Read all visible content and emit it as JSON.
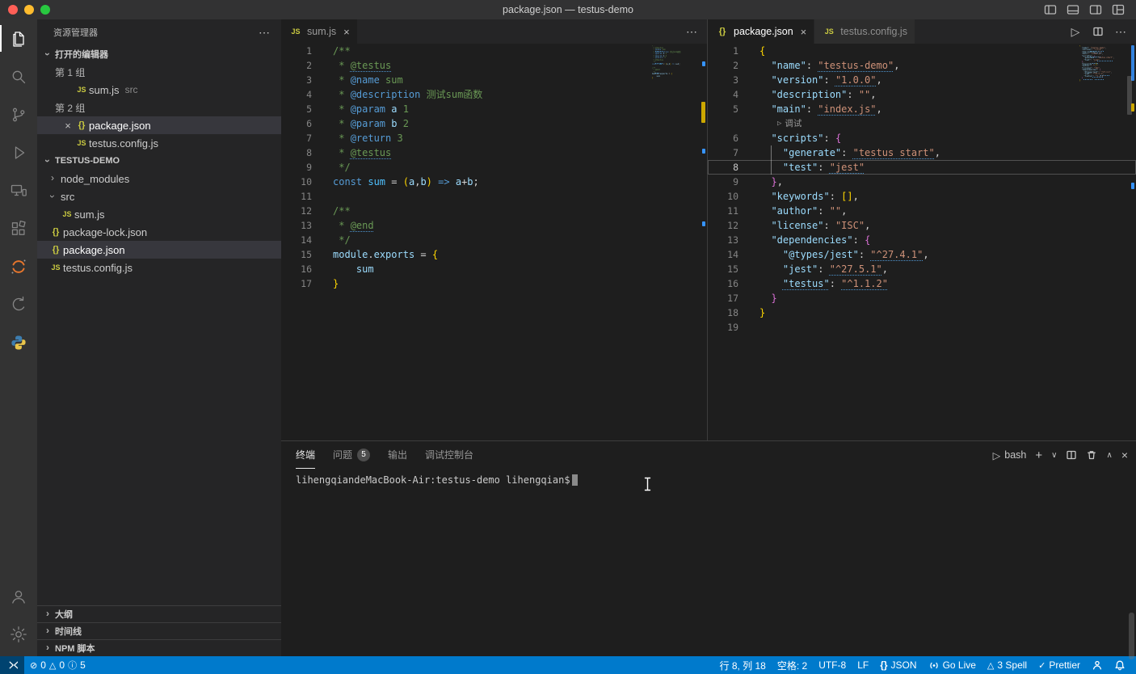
{
  "window": {
    "title": "package.json — testus-demo"
  },
  "colors": {
    "statusbar": "#007acc",
    "editor_bg": "#1e1e1e",
    "sidebar_bg": "#252526",
    "activitybar_bg": "#333333",
    "titlebar_bg": "#323233",
    "selection_row": "#37373d",
    "bracket_gold": "#ffd700",
    "bracket_pink": "#da70d6"
  },
  "titlebar_actions": [
    {
      "name": "toggle-primary-sidebar"
    },
    {
      "name": "toggle-panel"
    },
    {
      "name": "toggle-secondary-sidebar"
    },
    {
      "name": "customize-layout"
    }
  ],
  "activity_bar": {
    "top": [
      {
        "name": "explorer",
        "active": true
      },
      {
        "name": "search"
      },
      {
        "name": "source-control"
      },
      {
        "name": "run-and-debug"
      },
      {
        "name": "remote-explorer"
      },
      {
        "name": "extensions"
      },
      {
        "name": "jupyter"
      },
      {
        "name": "undo-history"
      },
      {
        "name": "python"
      }
    ],
    "bottom": [
      {
        "name": "account"
      },
      {
        "name": "settings"
      }
    ]
  },
  "sidebar": {
    "title": "资源管理器",
    "open_editors": {
      "label": "打开的编辑器",
      "groups": [
        {
          "label": "第 1 组",
          "items": [
            {
              "icon": "js",
              "label": "sum.js",
              "desc": "src"
            }
          ]
        },
        {
          "label": "第 2 组",
          "items": [
            {
              "icon": "json",
              "label": "package.json",
              "active": true,
              "closable": true
            },
            {
              "icon": "js",
              "label": "testus.config.js"
            }
          ]
        }
      ]
    },
    "project": {
      "label": "TESTUS-DEMO",
      "items": [
        {
          "kind": "folder",
          "label": "node_modules",
          "collapsed": true,
          "indent": 0
        },
        {
          "kind": "folder",
          "label": "src",
          "collapsed": false,
          "indent": 0
        },
        {
          "kind": "js",
          "label": "sum.js",
          "indent": 1
        },
        {
          "kind": "json",
          "label": "package-lock.json",
          "indent": 0
        },
        {
          "kind": "json",
          "label": "package.json",
          "indent": 0,
          "selected": true
        },
        {
          "kind": "js",
          "label": "testus.config.js",
          "indent": 0
        }
      ]
    },
    "bottom_sections": [
      {
        "label": "大纲"
      },
      {
        "label": "时间线"
      },
      {
        "label": "NPM 脚本"
      }
    ]
  },
  "editor1": {
    "tabs": [
      {
        "icon": "js",
        "label": "sum.js",
        "active": true,
        "dim": true,
        "closable": true
      }
    ],
    "lines": [
      {
        "tk": [
          {
            "t": "/**",
            "c": "cm"
          }
        ]
      },
      {
        "tk": [
          {
            "t": " * ",
            "c": "cm"
          },
          {
            "t": "@testus",
            "c": "cm u"
          }
        ]
      },
      {
        "tk": [
          {
            "t": " * ",
            "c": "cm"
          },
          {
            "t": "@name",
            "c": "tag"
          },
          {
            "t": " sum",
            "c": "cm"
          }
        ]
      },
      {
        "tk": [
          {
            "t": " * ",
            "c": "cm"
          },
          {
            "t": "@description",
            "c": "tag"
          },
          {
            "t": " 测试sum函数",
            "c": "cm"
          }
        ]
      },
      {
        "tk": [
          {
            "t": " * ",
            "c": "cm"
          },
          {
            "t": "@param",
            "c": "tag"
          },
          {
            "t": " ",
            "c": "cm"
          },
          {
            "t": "a",
            "c": "var"
          },
          {
            "t": " 1",
            "c": "cm"
          }
        ]
      },
      {
        "tk": [
          {
            "t": " * ",
            "c": "cm"
          },
          {
            "t": "@param",
            "c": "tag"
          },
          {
            "t": " ",
            "c": "cm"
          },
          {
            "t": "b",
            "c": "var"
          },
          {
            "t": " 2",
            "c": "cm"
          }
        ]
      },
      {
        "tk": [
          {
            "t": " * ",
            "c": "cm"
          },
          {
            "t": "@return",
            "c": "tag"
          },
          {
            "t": " 3",
            "c": "cm"
          }
        ]
      },
      {
        "tk": [
          {
            "t": " * ",
            "c": "cm"
          },
          {
            "t": "@testus",
            "c": "cm u"
          }
        ]
      },
      {
        "tk": [
          {
            "t": " */",
            "c": "cm"
          }
        ]
      },
      {
        "tk": [
          {
            "t": "const",
            "c": "kw"
          },
          {
            "t": " ",
            "c": "pn"
          },
          {
            "t": "sum",
            "c": "cvar"
          },
          {
            "t": " = ",
            "c": "pn"
          },
          {
            "t": "(",
            "c": "b1"
          },
          {
            "t": "a",
            "c": "var"
          },
          {
            "t": ",",
            "c": "pn"
          },
          {
            "t": "b",
            "c": "var"
          },
          {
            "t": ")",
            "c": "b1"
          },
          {
            "t": " ",
            "c": "pn"
          },
          {
            "t": "=>",
            "c": "kw"
          },
          {
            "t": " ",
            "c": "pn"
          },
          {
            "t": "a",
            "c": "var"
          },
          {
            "t": "+",
            "c": "pn"
          },
          {
            "t": "b",
            "c": "var"
          },
          {
            "t": ";",
            "c": "pn"
          }
        ]
      },
      {
        "tk": []
      },
      {
        "tk": [
          {
            "t": "/**",
            "c": "cm"
          }
        ]
      },
      {
        "tk": [
          {
            "t": " * ",
            "c": "cm"
          },
          {
            "t": "@end",
            "c": "cm u"
          }
        ]
      },
      {
        "tk": [
          {
            "t": " */",
            "c": "cm"
          }
        ]
      },
      {
        "tk": [
          {
            "t": "module",
            "c": "var"
          },
          {
            "t": ".",
            "c": "pn"
          },
          {
            "t": "exports",
            "c": "var"
          },
          {
            "t": " = ",
            "c": "pn"
          },
          {
            "t": "{",
            "c": "b1"
          }
        ]
      },
      {
        "tk": [
          {
            "t": "    ",
            "c": "pn"
          },
          {
            "t": "sum",
            "c": "var"
          }
        ]
      },
      {
        "tk": [
          {
            "t": "}",
            "c": "b1"
          }
        ]
      }
    ]
  },
  "editor2": {
    "tabs": [
      {
        "icon": "json",
        "label": "package.json",
        "active": true,
        "closable": true
      },
      {
        "icon": "js",
        "label": "testus.config.js"
      }
    ],
    "codelens_label": "调试",
    "lines": [
      {
        "tk": [
          {
            "t": "{",
            "c": "b1"
          }
        ]
      },
      {
        "tk": [
          {
            "t": "  ",
            "c": "pn"
          },
          {
            "t": "\"name\"",
            "c": "key"
          },
          {
            "t": ": ",
            "c": "pn"
          },
          {
            "t": "\"testus-demo\"",
            "c": "str u"
          },
          {
            "t": ",",
            "c": "pn"
          }
        ]
      },
      {
        "tk": [
          {
            "t": "  ",
            "c": "pn"
          },
          {
            "t": "\"version\"",
            "c": "key"
          },
          {
            "t": ": ",
            "c": "pn"
          },
          {
            "t": "\"1.0.0\"",
            "c": "str u"
          },
          {
            "t": ",",
            "c": "pn"
          }
        ]
      },
      {
        "tk": [
          {
            "t": "  ",
            "c": "pn"
          },
          {
            "t": "\"description\"",
            "c": "key"
          },
          {
            "t": ": ",
            "c": "pn"
          },
          {
            "t": "\"\"",
            "c": "str"
          },
          {
            "t": ",",
            "c": "pn"
          }
        ]
      },
      {
        "tk": [
          {
            "t": "  ",
            "c": "pn"
          },
          {
            "t": "\"main\"",
            "c": "key"
          },
          {
            "t": ": ",
            "c": "pn"
          },
          {
            "t": "\"index.js\"",
            "c": "str u"
          },
          {
            "t": ",",
            "c": "pn"
          }
        ]
      },
      {
        "lens": true
      },
      {
        "tk": [
          {
            "t": "  ",
            "c": "pn"
          },
          {
            "t": "\"scripts\"",
            "c": "key"
          },
          {
            "t": ": ",
            "c": "pn"
          },
          {
            "t": "{",
            "c": "b2"
          }
        ]
      },
      {
        "tk": [
          {
            "t": "    ",
            "c": "pn"
          },
          {
            "t": "\"generate\"",
            "c": "key"
          },
          {
            "t": ": ",
            "c": "pn"
          },
          {
            "t": "\"testus start\"",
            "c": "str u"
          },
          {
            "t": ",",
            "c": "pn"
          }
        ]
      },
      {
        "cur": true,
        "tk": [
          {
            "t": "    ",
            "c": "pn"
          },
          {
            "t": "\"test\"",
            "c": "key"
          },
          {
            "t": ": ",
            "c": "pn"
          },
          {
            "t": "\"jest\"",
            "c": "str u"
          }
        ]
      },
      {
        "tk": [
          {
            "t": "  ",
            "c": "pn"
          },
          {
            "t": "}",
            "c": "b2"
          },
          {
            "t": ",",
            "c": "pn"
          }
        ]
      },
      {
        "tk": [
          {
            "t": "  ",
            "c": "pn"
          },
          {
            "t": "\"keywords\"",
            "c": "key"
          },
          {
            "t": ": ",
            "c": "pn"
          },
          {
            "t": "[]",
            "c": "b1"
          },
          {
            "t": ",",
            "c": "pn"
          }
        ]
      },
      {
        "tk": [
          {
            "t": "  ",
            "c": "pn"
          },
          {
            "t": "\"author\"",
            "c": "key"
          },
          {
            "t": ": ",
            "c": "pn"
          },
          {
            "t": "\"\"",
            "c": "str"
          },
          {
            "t": ",",
            "c": "pn"
          }
        ]
      },
      {
        "tk": [
          {
            "t": "  ",
            "c": "pn"
          },
          {
            "t": "\"license\"",
            "c": "key"
          },
          {
            "t": ": ",
            "c": "pn"
          },
          {
            "t": "\"ISC\"",
            "c": "str"
          },
          {
            "t": ",",
            "c": "pn"
          }
        ]
      },
      {
        "tk": [
          {
            "t": "  ",
            "c": "pn"
          },
          {
            "t": "\"dependencies\"",
            "c": "key"
          },
          {
            "t": ": ",
            "c": "pn"
          },
          {
            "t": "{",
            "c": "b2"
          }
        ]
      },
      {
        "tk": [
          {
            "t": "    ",
            "c": "pn"
          },
          {
            "t": "\"@types/jest\"",
            "c": "key"
          },
          {
            "t": ": ",
            "c": "pn"
          },
          {
            "t": "\"^27.4.1\"",
            "c": "str u"
          },
          {
            "t": ",",
            "c": "pn"
          }
        ]
      },
      {
        "tk": [
          {
            "t": "    ",
            "c": "pn"
          },
          {
            "t": "\"jest\"",
            "c": "key"
          },
          {
            "t": ": ",
            "c": "pn"
          },
          {
            "t": "\"^27.5.1\"",
            "c": "str u"
          },
          {
            "t": ",",
            "c": "pn"
          }
        ]
      },
      {
        "tk": [
          {
            "t": "    ",
            "c": "pn"
          },
          {
            "t": "\"testus\"",
            "c": "key u"
          },
          {
            "t": ": ",
            "c": "pn"
          },
          {
            "t": "\"^1.1.2\"",
            "c": "str u"
          }
        ]
      },
      {
        "tk": [
          {
            "t": "  ",
            "c": "pn"
          },
          {
            "t": "}",
            "c": "b2"
          }
        ]
      },
      {
        "tk": [
          {
            "t": "}",
            "c": "b1"
          }
        ]
      },
      {
        "tk": []
      }
    ]
  },
  "panel": {
    "tabs": [
      {
        "label": "终端",
        "active": true
      },
      {
        "label": "问题",
        "badge": "5"
      },
      {
        "label": "输出"
      },
      {
        "label": "调试控制台"
      }
    ],
    "shell": "bash",
    "terminal_prompt": "lihengqiandeMacBook-Air:testus-demo lihengqian$"
  },
  "status_bar": {
    "problems": {
      "errors": "0",
      "warnings": "0",
      "infos": "5"
    },
    "right": [
      {
        "name": "cursor-position",
        "label": "行 8, 列 18"
      },
      {
        "name": "indentation",
        "label": "空格: 2"
      },
      {
        "name": "encoding",
        "label": "UTF-8"
      },
      {
        "name": "eol",
        "label": "LF"
      },
      {
        "name": "language-mode",
        "label": "JSON",
        "icon": "braces"
      },
      {
        "name": "go-live",
        "label": "Go Live",
        "icon": "broadcast"
      },
      {
        "name": "spell-checker",
        "label": "3 Spell",
        "icon": "warning"
      },
      {
        "name": "prettier",
        "label": "Prettier",
        "icon": "check"
      },
      {
        "name": "feedback",
        "label": "",
        "icon": "person"
      },
      {
        "name": "notifications",
        "label": "",
        "icon": "bell"
      }
    ]
  }
}
